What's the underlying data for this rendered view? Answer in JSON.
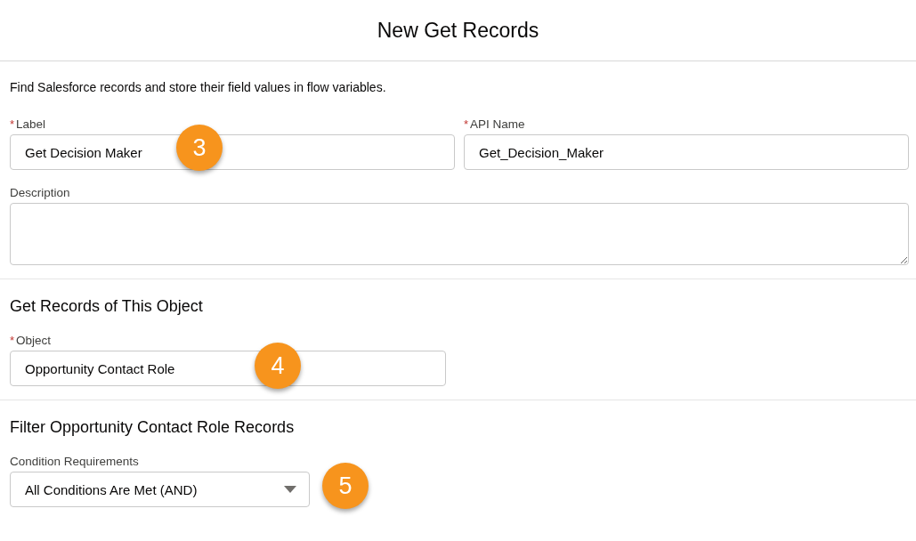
{
  "dialog": {
    "title": "New Get Records"
  },
  "intro": "Find Salesforce records and store their field values in flow variables.",
  "sections": [
    {
      "fields": [
        {
          "kind": "text",
          "required_mark": "*",
          "label": "Label",
          "value": "Get Decision Maker",
          "callout": "3"
        },
        {
          "kind": "text",
          "required_mark": "*",
          "label": "API Name",
          "value": "Get_Decision_Maker"
        },
        {
          "kind": "textarea",
          "label": "Description"
        }
      ]
    },
    {
      "heading": "Get Records of This Object",
      "fields": [
        {
          "kind": "text",
          "required_mark": "*",
          "label": "Object",
          "value": "Opportunity Contact Role",
          "callout": "4"
        }
      ]
    },
    {
      "heading": "Filter Opportunity Contact Role Records",
      "fields": [
        {
          "kind": "select",
          "label": "Condition Requirements",
          "value": "All Conditions Are Met (AND)",
          "callout": "5"
        }
      ]
    }
  ]
}
